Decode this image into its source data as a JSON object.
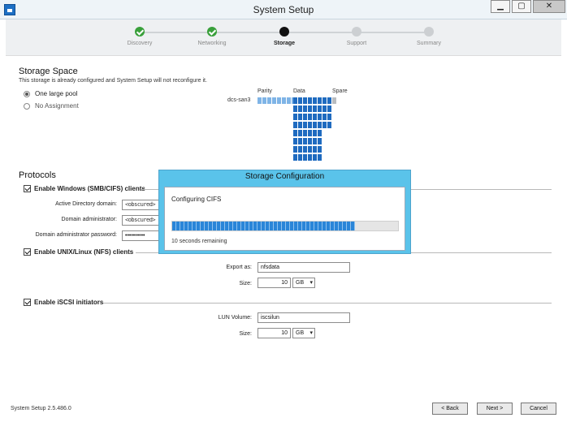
{
  "window": {
    "title": "System Setup",
    "controls": [
      "▁",
      "▢",
      "✕"
    ]
  },
  "steps": [
    {
      "label": "Discovery",
      "state": "done"
    },
    {
      "label": "Networking",
      "state": "done"
    },
    {
      "label": "Storage",
      "state": "current"
    },
    {
      "label": "Support",
      "state": "pending"
    },
    {
      "label": "Summary",
      "state": "pending"
    }
  ],
  "storage": {
    "title": "Storage Space",
    "note": "This storage is already configured and System Setup will not reconfigure it.",
    "options": [
      {
        "label": "One large pool",
        "checked": true
      },
      {
        "label": "No Assignment",
        "checked": false
      }
    ],
    "device_name": "dcs-san3",
    "headers": {
      "parity": "Parity",
      "data": "Data",
      "spare": "Spare"
    },
    "disk_counts": {
      "parity": 8,
      "data_columns": 8,
      "data_rows_full": 4,
      "data_rows_narrow": 4,
      "spare": 1
    }
  },
  "protocols": {
    "title": "Protocols",
    "smb": {
      "label": "Enable Windows (SMB/CIFS) clients",
      "checked": true,
      "fields": {
        "ad_domain_label": "Active Directory domain:",
        "ad_domain_value": "<obscured>",
        "admin_label": "Domain administrator:",
        "admin_value": "<obscured>",
        "password_label": "Domain administrator password:",
        "password_value": "••••••••••"
      }
    },
    "nfs": {
      "label": "Enable UNIX/Linux (NFS) clients",
      "checked": true,
      "export_label": "Export as:",
      "export_value": "nfsdata",
      "size_label": "Size:",
      "size_value": "10",
      "size_unit": "GB"
    },
    "iscsi": {
      "label": "Enable iSCSI initiators",
      "checked": true,
      "lun_label": "LUN Volume:",
      "lun_value": "iscsilun",
      "size_label": "Size:",
      "size_value": "10",
      "size_unit": "GB"
    }
  },
  "footer": {
    "version": "System Setup 2.5.486.0",
    "back": "< Back",
    "next": "Next >",
    "cancel": "Cancel"
  },
  "modal": {
    "title": "Storage Configuration",
    "status": "Configuring CIFS",
    "progress": 0.81,
    "remaining": "10 seconds remaining"
  },
  "colors": {
    "done": "#39a03b",
    "parity": "#7fb4e6",
    "data": "#1f6bc0",
    "spare": "#b9bcbf",
    "modal": "#5ac3ea"
  }
}
